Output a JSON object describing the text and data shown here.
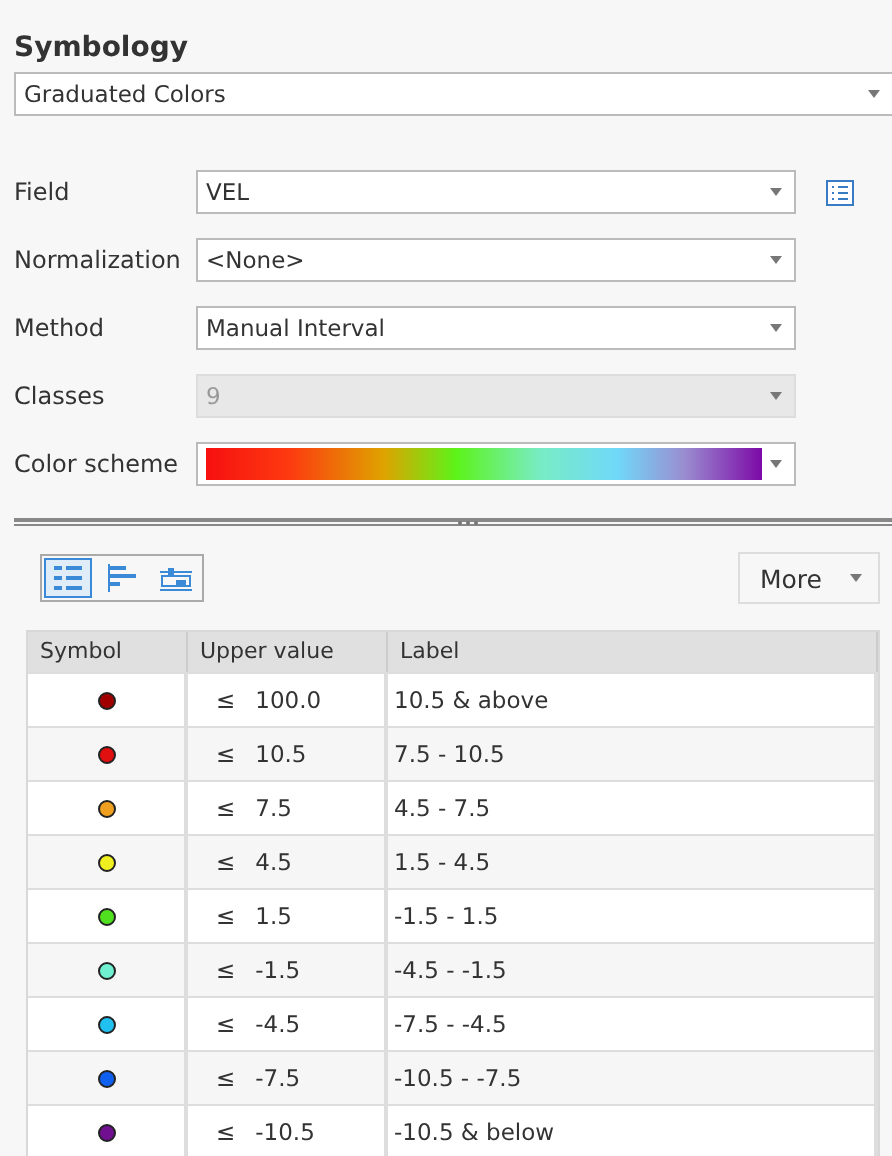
{
  "title": "Symbology",
  "renderer": {
    "value": "Graduated Colors"
  },
  "fields": [
    {
      "label": "Field",
      "kind": "select",
      "value": "VEL",
      "disabled": false,
      "side_icon": true
    },
    {
      "label": "Normalization",
      "kind": "select",
      "value": "<None>",
      "disabled": false,
      "side_icon": false
    },
    {
      "label": "Method",
      "kind": "select",
      "value": "Manual Interval",
      "disabled": false,
      "side_icon": false
    },
    {
      "label": "Classes",
      "kind": "select",
      "value": "9",
      "disabled": true,
      "side_icon": false
    },
    {
      "label": "Color scheme",
      "kind": "ramp",
      "disabled": false,
      "side_icon": false
    }
  ],
  "view_tabs": [
    {
      "kind": "classes",
      "selected": true
    },
    {
      "kind": "histogram",
      "selected": false
    },
    {
      "kind": "scale",
      "selected": false
    }
  ],
  "more_button": "More",
  "table": {
    "columns": [
      "Symbol",
      "Upper value",
      "Label"
    ],
    "rows": [
      {
        "color": "#a00000",
        "op": "≤",
        "upper": "100.0",
        "label": "10.5 & above"
      },
      {
        "color": "#e01010",
        "op": "≤",
        "upper": "10.5",
        "label": "7.5 - 10.5"
      },
      {
        "color": "#f0a020",
        "op": "≤",
        "upper": "7.5",
        "label": "4.5 - 7.5"
      },
      {
        "color": "#f0f020",
        "op": "≤",
        "upper": "4.5",
        "label": "1.5 - 4.5"
      },
      {
        "color": "#50e020",
        "op": "≤",
        "upper": "1.5",
        "label": "-1.5 - 1.5"
      },
      {
        "color": "#70f0d0",
        "op": "≤",
        "upper": "-1.5",
        "label": "-4.5 - -1.5"
      },
      {
        "color": "#20c0f0",
        "op": "≤",
        "upper": "-4.5",
        "label": "-7.5 - -4.5"
      },
      {
        "color": "#1060f0",
        "op": "≤",
        "upper": "-7.5",
        "label": "-10.5 - -7.5"
      },
      {
        "color": "#701090",
        "op": "≤",
        "upper": "-10.5",
        "label": "-10.5 & below"
      }
    ]
  }
}
